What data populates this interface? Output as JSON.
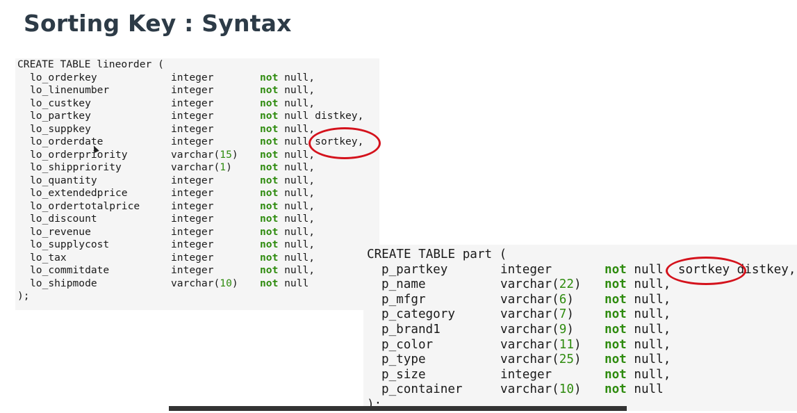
{
  "slide": {
    "title": "Sorting Key : Syntax"
  },
  "table1": {
    "header": "CREATE TABLE lineorder (",
    "rows": [
      {
        "name": "lo_orderkey",
        "type": "integer",
        "kw": "not",
        "rest": " null,"
      },
      {
        "name": "lo_linenumber",
        "type": "integer",
        "kw": "not",
        "rest": " null,"
      },
      {
        "name": "lo_custkey",
        "type": "integer",
        "kw": "not",
        "rest": " null,"
      },
      {
        "name": "lo_partkey",
        "type": "integer",
        "kw": "not",
        "rest": " null distkey,"
      },
      {
        "name": "lo_suppkey",
        "type": "integer",
        "kw": "not",
        "rest": " null,"
      },
      {
        "name": "lo_orderdate",
        "type": "integer",
        "kw": "not",
        "rest": " null sortkey,"
      },
      {
        "name": "lo_orderpriority",
        "type": "varchar(15)",
        "kw": "not",
        "rest": " null,"
      },
      {
        "name": "lo_shippriority",
        "type": "varchar(1)",
        "kw": "not",
        "rest": " null,"
      },
      {
        "name": "lo_quantity",
        "type": "integer",
        "kw": "not",
        "rest": " null,"
      },
      {
        "name": "lo_extendedprice",
        "type": "integer",
        "kw": "not",
        "rest": " null,"
      },
      {
        "name": "lo_ordertotalprice",
        "type": "integer",
        "kw": "not",
        "rest": " null,"
      },
      {
        "name": "lo_discount",
        "type": "integer",
        "kw": "not",
        "rest": " null,"
      },
      {
        "name": "lo_revenue",
        "type": "integer",
        "kw": "not",
        "rest": " null,"
      },
      {
        "name": "lo_supplycost",
        "type": "integer",
        "kw": "not",
        "rest": " null,"
      },
      {
        "name": "lo_tax",
        "type": "integer",
        "kw": "not",
        "rest": " null,"
      },
      {
        "name": "lo_commitdate",
        "type": "integer",
        "kw": "not",
        "rest": " null,"
      },
      {
        "name": "lo_shipmode",
        "type": "varchar(10)",
        "kw": "not",
        "rest": " null"
      }
    ],
    "footer": ");"
  },
  "table2": {
    "header": "CREATE TABLE part (",
    "rows": [
      {
        "name": "p_partkey",
        "type": "integer",
        "kw": "not",
        "rest": " null  sortkey distkey,"
      },
      {
        "name": "p_name",
        "type": "varchar(22)",
        "kw": "not",
        "rest": " null,"
      },
      {
        "name": "p_mfgr",
        "type": "varchar(6)",
        "kw": "not",
        "rest": " null,"
      },
      {
        "name": "p_category",
        "type": "varchar(7)",
        "kw": "not",
        "rest": " null,"
      },
      {
        "name": "p_brand1",
        "type": "varchar(9)",
        "kw": "not",
        "rest": " null,"
      },
      {
        "name": "p_color",
        "type": "varchar(11)",
        "kw": "not",
        "rest": " null,"
      },
      {
        "name": "p_type",
        "type": "varchar(25)",
        "kw": "not",
        "rest": " null,"
      },
      {
        "name": "p_size",
        "type": "integer",
        "kw": "not",
        "rest": " null,"
      },
      {
        "name": "p_container",
        "type": "varchar(10)",
        "kw": "not",
        "rest": " null"
      }
    ],
    "footer": ");"
  },
  "colors": {
    "keyword": "#2e8b0e",
    "highlight_circle": "#d4121c",
    "title": "#2d3b47"
  }
}
